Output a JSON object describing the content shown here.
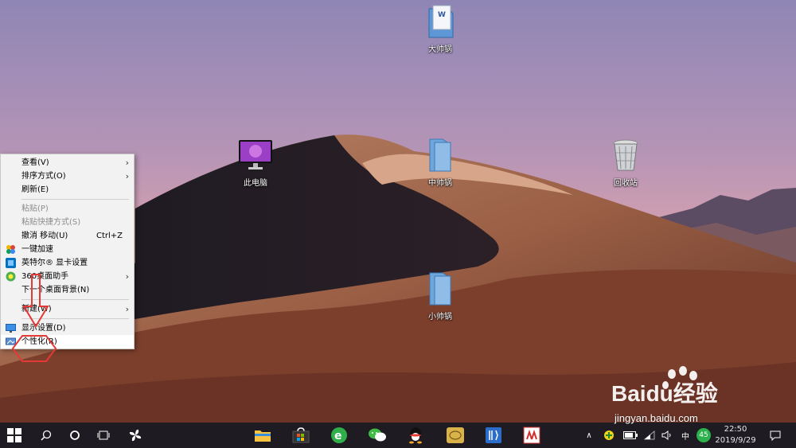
{
  "desktop": {
    "icons": [
      {
        "label": "大帅锅",
        "icon": "word-document-icon"
      },
      {
        "label": "此电脑",
        "icon": "computer-icon"
      },
      {
        "label": "中帅锅",
        "icon": "folder-icon"
      },
      {
        "label": "回收站",
        "icon": "recycle-bin-icon"
      },
      {
        "label": "小帅锅",
        "icon": "folder-icon"
      }
    ]
  },
  "context_menu": {
    "items": [
      {
        "label": "查看(V)",
        "submenu": true
      },
      {
        "label": "排序方式(O)",
        "submenu": true
      },
      {
        "label": "刷新(E)"
      },
      {
        "label": "粘贴(P)",
        "disabled": true
      },
      {
        "label": "粘贴快捷方式(S)",
        "disabled": true
      },
      {
        "label": "撤消 移动(U)",
        "shortcut": "Ctrl+Z"
      },
      {
        "label": "一键加速",
        "icon": "speedup-icon"
      },
      {
        "label": "英特尔® 显卡设置",
        "icon": "intel-graphics-icon"
      },
      {
        "label": "360桌面助手",
        "icon": "360-assistant-icon",
        "submenu": true
      },
      {
        "label": "下一个桌面背景(N)"
      },
      {
        "label": "新建(W)",
        "submenu": true
      },
      {
        "label": "显示设置(D)",
        "icon": "display-settings-icon"
      },
      {
        "label": "个性化(R)",
        "icon": "personalize-icon",
        "highlighted": true
      }
    ]
  },
  "taskbar": {
    "tray_ime": "中",
    "tray_badge": "45",
    "clock_time": "22:50",
    "clock_date": "2019/9/29"
  },
  "watermark": {
    "brand": "Baidu经验",
    "url": "jingyan.baidu.com"
  },
  "colors": {
    "taskbar": "#1e1c22",
    "menu_bg": "#f2f2f2",
    "annotation": "#e53935"
  }
}
